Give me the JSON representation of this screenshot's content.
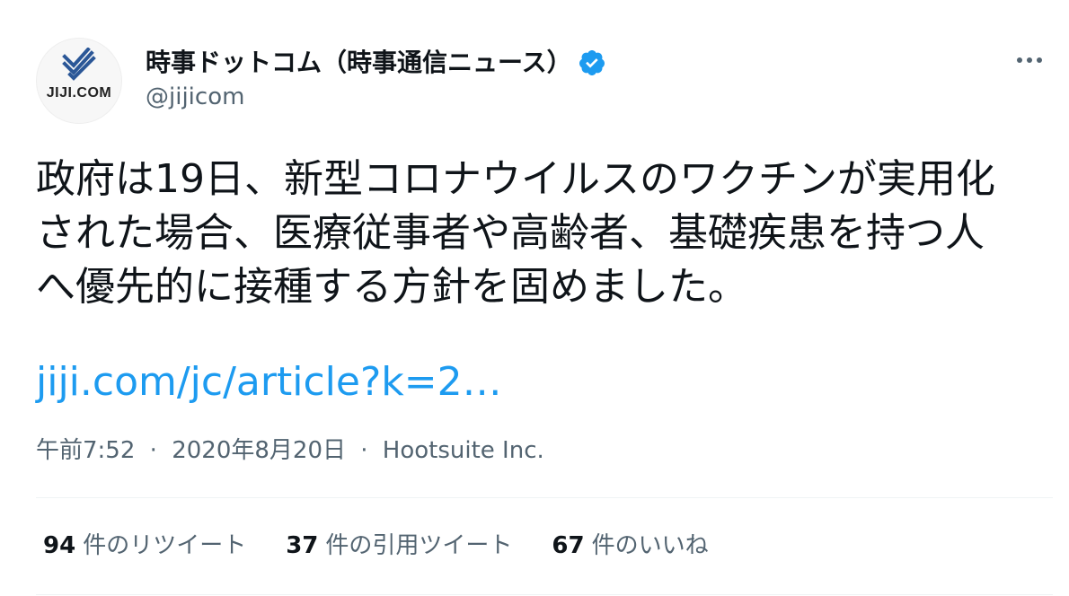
{
  "author": {
    "avatar_text": "JIJI.COM",
    "display_name": "時事ドットコム（時事通信ニュース）",
    "handle": "@jijicom",
    "verified": true
  },
  "icons": {
    "verified": "verified-badge-icon",
    "more": "more-options-icon"
  },
  "tweet": {
    "text": "政府は19日、新型コロナウイルスのワクチンが実用化\nされた場合、医療従事者や高齢者、基礎疾患を持つ人\nへ優先的に接種する方針を固めました。",
    "link": "jiji.com/jc/article?k=2…"
  },
  "meta": {
    "time": "午前7:52",
    "date": "2020年8月20日",
    "source": "Hootsuite Inc.",
    "separator": "·"
  },
  "stats": [
    {
      "count": "94",
      "label": "件のリツイート"
    },
    {
      "count": "37",
      "label": "件の引用ツイート"
    },
    {
      "count": "67",
      "label": "件のいいね"
    }
  ],
  "colors": {
    "link": "#1d9bf0",
    "verified": "#1d9bf0",
    "secondary_text": "#536471",
    "logo_blue": "#2b5797"
  }
}
